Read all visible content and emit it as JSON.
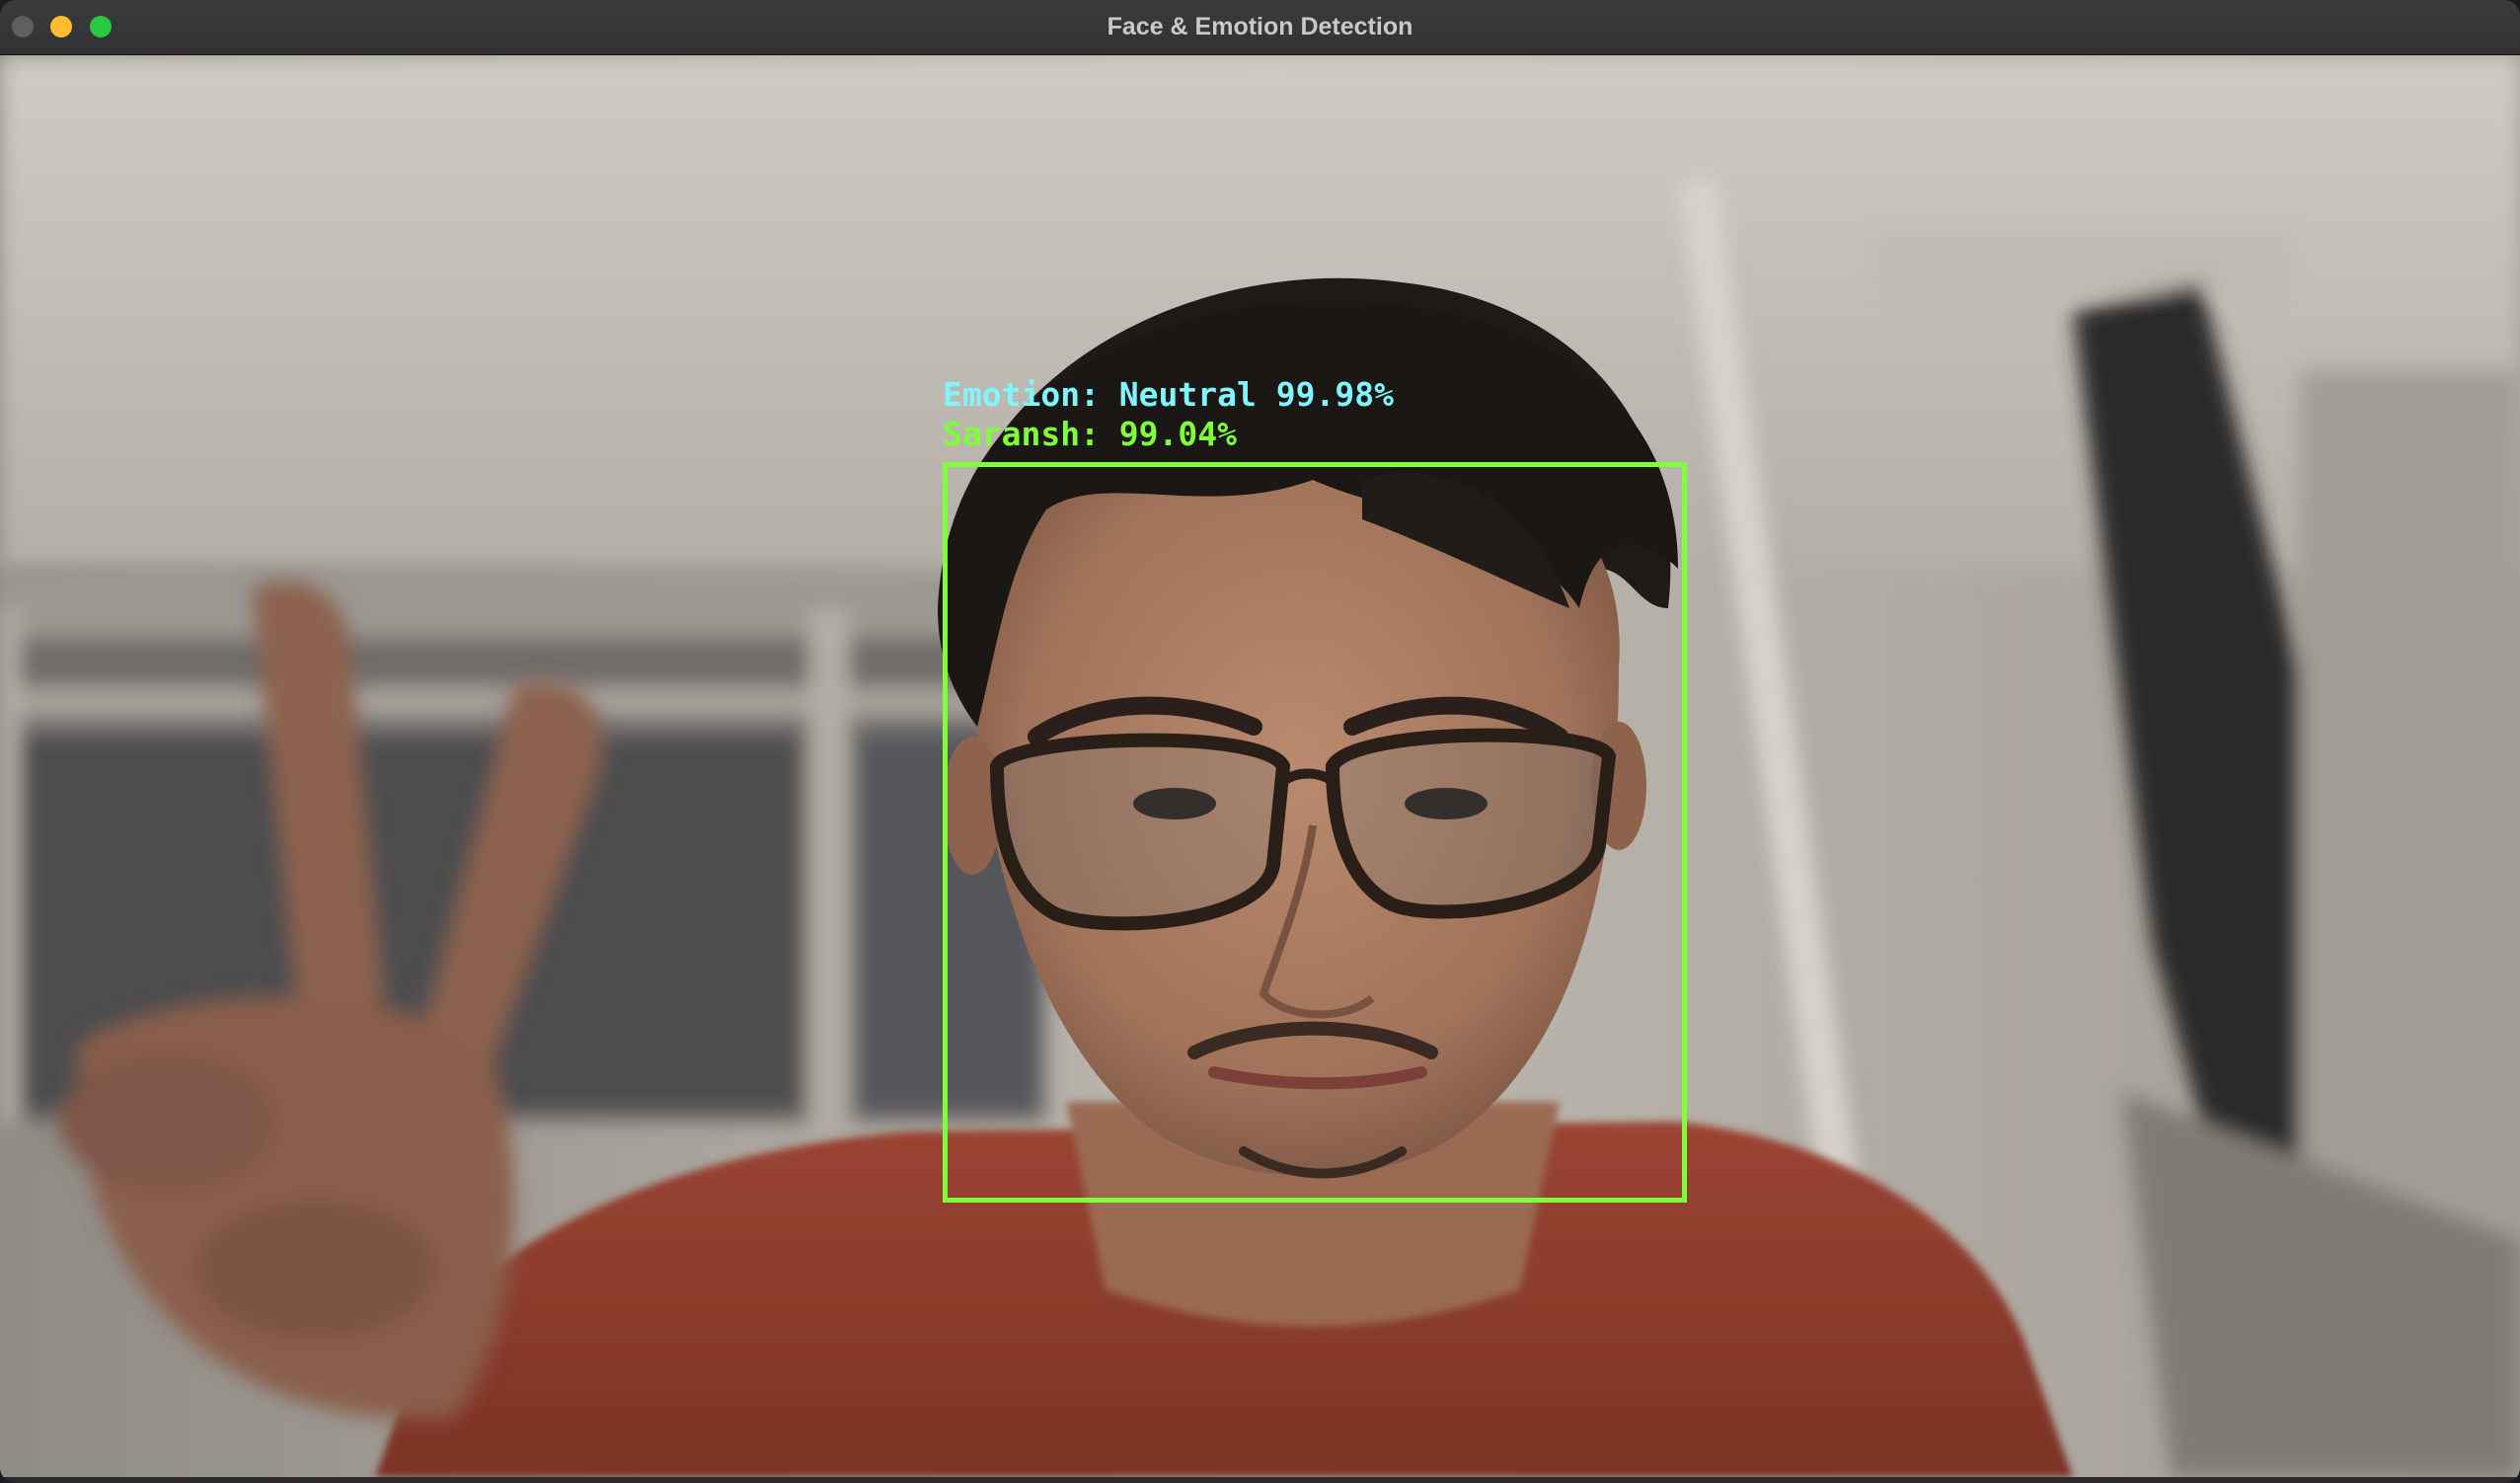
{
  "window": {
    "title": "Face & Emotion Detection"
  },
  "detection": {
    "emotion_text": "Emotion: Neutral 99.98%",
    "identity_text": "Saransh: 99.04%",
    "emotion_color": "#7ff5ff",
    "box_color": "#7fff3a"
  }
}
